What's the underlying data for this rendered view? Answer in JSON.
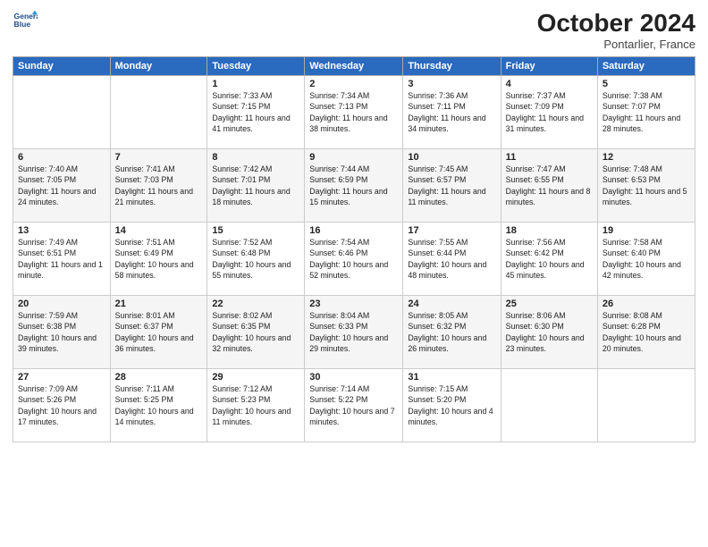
{
  "logo": {
    "line1": "General",
    "line2": "Blue"
  },
  "title": "October 2024",
  "location": "Pontarlier, France",
  "days_header": [
    "Sunday",
    "Monday",
    "Tuesday",
    "Wednesday",
    "Thursday",
    "Friday",
    "Saturday"
  ],
  "weeks": [
    [
      {
        "day": "",
        "info": ""
      },
      {
        "day": "",
        "info": ""
      },
      {
        "day": "1",
        "info": "Sunrise: 7:33 AM\nSunset: 7:15 PM\nDaylight: 11 hours and 41 minutes."
      },
      {
        "day": "2",
        "info": "Sunrise: 7:34 AM\nSunset: 7:13 PM\nDaylight: 11 hours and 38 minutes."
      },
      {
        "day": "3",
        "info": "Sunrise: 7:36 AM\nSunset: 7:11 PM\nDaylight: 11 hours and 34 minutes."
      },
      {
        "day": "4",
        "info": "Sunrise: 7:37 AM\nSunset: 7:09 PM\nDaylight: 11 hours and 31 minutes."
      },
      {
        "day": "5",
        "info": "Sunrise: 7:38 AM\nSunset: 7:07 PM\nDaylight: 11 hours and 28 minutes."
      }
    ],
    [
      {
        "day": "6",
        "info": "Sunrise: 7:40 AM\nSunset: 7:05 PM\nDaylight: 11 hours and 24 minutes."
      },
      {
        "day": "7",
        "info": "Sunrise: 7:41 AM\nSunset: 7:03 PM\nDaylight: 11 hours and 21 minutes."
      },
      {
        "day": "8",
        "info": "Sunrise: 7:42 AM\nSunset: 7:01 PM\nDaylight: 11 hours and 18 minutes."
      },
      {
        "day": "9",
        "info": "Sunrise: 7:44 AM\nSunset: 6:59 PM\nDaylight: 11 hours and 15 minutes."
      },
      {
        "day": "10",
        "info": "Sunrise: 7:45 AM\nSunset: 6:57 PM\nDaylight: 11 hours and 11 minutes."
      },
      {
        "day": "11",
        "info": "Sunrise: 7:47 AM\nSunset: 6:55 PM\nDaylight: 11 hours and 8 minutes."
      },
      {
        "day": "12",
        "info": "Sunrise: 7:48 AM\nSunset: 6:53 PM\nDaylight: 11 hours and 5 minutes."
      }
    ],
    [
      {
        "day": "13",
        "info": "Sunrise: 7:49 AM\nSunset: 6:51 PM\nDaylight: 11 hours and 1 minute."
      },
      {
        "day": "14",
        "info": "Sunrise: 7:51 AM\nSunset: 6:49 PM\nDaylight: 10 hours and 58 minutes."
      },
      {
        "day": "15",
        "info": "Sunrise: 7:52 AM\nSunset: 6:48 PM\nDaylight: 10 hours and 55 minutes."
      },
      {
        "day": "16",
        "info": "Sunrise: 7:54 AM\nSunset: 6:46 PM\nDaylight: 10 hours and 52 minutes."
      },
      {
        "day": "17",
        "info": "Sunrise: 7:55 AM\nSunset: 6:44 PM\nDaylight: 10 hours and 48 minutes."
      },
      {
        "day": "18",
        "info": "Sunrise: 7:56 AM\nSunset: 6:42 PM\nDaylight: 10 hours and 45 minutes."
      },
      {
        "day": "19",
        "info": "Sunrise: 7:58 AM\nSunset: 6:40 PM\nDaylight: 10 hours and 42 minutes."
      }
    ],
    [
      {
        "day": "20",
        "info": "Sunrise: 7:59 AM\nSunset: 6:38 PM\nDaylight: 10 hours and 39 minutes."
      },
      {
        "day": "21",
        "info": "Sunrise: 8:01 AM\nSunset: 6:37 PM\nDaylight: 10 hours and 36 minutes."
      },
      {
        "day": "22",
        "info": "Sunrise: 8:02 AM\nSunset: 6:35 PM\nDaylight: 10 hours and 32 minutes."
      },
      {
        "day": "23",
        "info": "Sunrise: 8:04 AM\nSunset: 6:33 PM\nDaylight: 10 hours and 29 minutes."
      },
      {
        "day": "24",
        "info": "Sunrise: 8:05 AM\nSunset: 6:32 PM\nDaylight: 10 hours and 26 minutes."
      },
      {
        "day": "25",
        "info": "Sunrise: 8:06 AM\nSunset: 6:30 PM\nDaylight: 10 hours and 23 minutes."
      },
      {
        "day": "26",
        "info": "Sunrise: 8:08 AM\nSunset: 6:28 PM\nDaylight: 10 hours and 20 minutes."
      }
    ],
    [
      {
        "day": "27",
        "info": "Sunrise: 7:09 AM\nSunset: 5:26 PM\nDaylight: 10 hours and 17 minutes."
      },
      {
        "day": "28",
        "info": "Sunrise: 7:11 AM\nSunset: 5:25 PM\nDaylight: 10 hours and 14 minutes."
      },
      {
        "day": "29",
        "info": "Sunrise: 7:12 AM\nSunset: 5:23 PM\nDaylight: 10 hours and 11 minutes."
      },
      {
        "day": "30",
        "info": "Sunrise: 7:14 AM\nSunset: 5:22 PM\nDaylight: 10 hours and 7 minutes."
      },
      {
        "day": "31",
        "info": "Sunrise: 7:15 AM\nSunset: 5:20 PM\nDaylight: 10 hours and 4 minutes."
      },
      {
        "day": "",
        "info": ""
      },
      {
        "day": "",
        "info": ""
      }
    ]
  ]
}
